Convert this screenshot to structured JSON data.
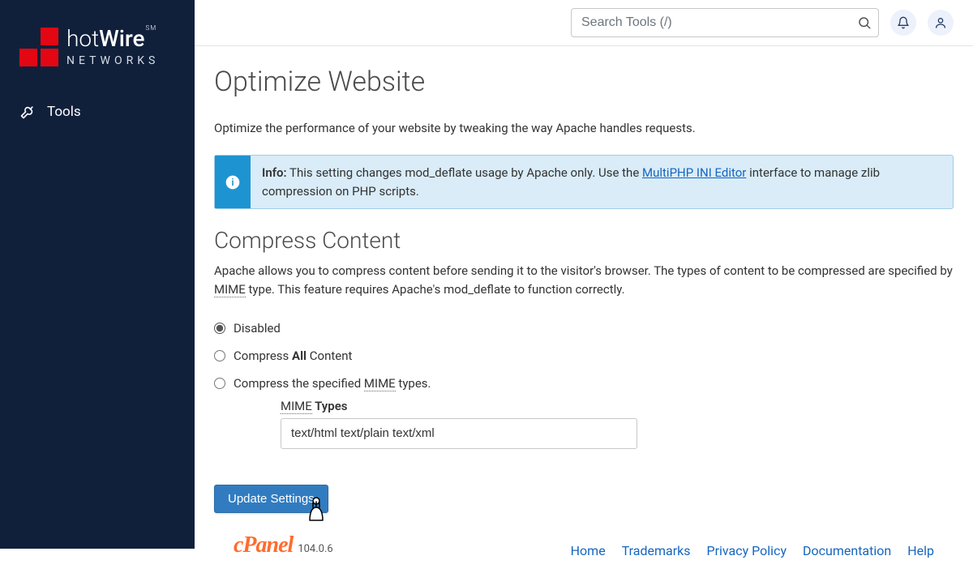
{
  "brand": {
    "name_part1": "hot",
    "name_part2": "Wire",
    "sm": "SM",
    "sub": "NETWORKS"
  },
  "sidebar": {
    "tools_label": "Tools"
  },
  "topbar": {
    "search_placeholder": "Search Tools (/)"
  },
  "page": {
    "title": "Optimize Website",
    "description": "Optimize the performance of your website by tweaking the way Apache handles requests."
  },
  "info": {
    "label": "Info:",
    "text_before_link": " This setting changes mod_deflate usage by Apache only. Use the ",
    "link_text": "MultiPHP INI Editor",
    "text_after_link": " interface to manage zlib compression on PHP scripts."
  },
  "compress": {
    "title": "Compress Content",
    "desc_part1": "Apache allows you to compress content before sending it to the visitor's browser. The types of content to be compressed are specified by ",
    "mime_abbr": "MIME",
    "desc_part2": " type. This feature requires Apache's mod_deflate to function correctly.",
    "radios": {
      "disabled": "Disabled",
      "all_pre": "Compress ",
      "all_strong": "All",
      "all_post": " Content",
      "specified_pre": "Compress the specified ",
      "specified_abbr": "MIME",
      "specified_post": " types."
    },
    "mime_label_abbr": "MIME",
    "mime_label_post": " Types",
    "mime_value": "text/html text/plain text/xml"
  },
  "actions": {
    "update": "Update Settings"
  },
  "footer": {
    "cpanel": "cPanel",
    "version": "104.0.6",
    "links": {
      "home": "Home",
      "trademarks": "Trademarks",
      "privacy": "Privacy Policy",
      "docs": "Documentation",
      "help": "Help"
    }
  }
}
